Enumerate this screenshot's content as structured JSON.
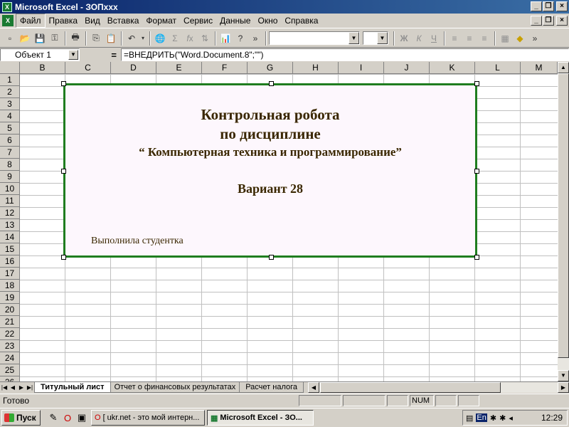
{
  "window": {
    "title": "Microsoft Excel - ЗОПxxx",
    "app_icon": "excel-icon"
  },
  "menu": {
    "items": [
      "Файл",
      "Правка",
      "Вид",
      "Вставка",
      "Формат",
      "Сервис",
      "Данные",
      "Окно",
      "Справка"
    ]
  },
  "toolbar": {
    "bold": "Ж",
    "italic": "К",
    "underline": "Ч",
    "more": "»"
  },
  "formula_bar": {
    "name_box": "Объект 1",
    "equals": "=",
    "formula": "=ВНЕДРИТЬ(\"Word.Document.8\";\"\")"
  },
  "columns": [
    "B",
    "C",
    "D",
    "E",
    "F",
    "G",
    "H",
    "I",
    "J",
    "K",
    "L",
    "M"
  ],
  "rows": [
    "1",
    "2",
    "3",
    "4",
    "5",
    "6",
    "7",
    "8",
    "9",
    "10",
    "11",
    "12",
    "13",
    "14",
    "15",
    "16",
    "17",
    "18",
    "19",
    "20",
    "21",
    "22",
    "23",
    "24",
    "25",
    "26"
  ],
  "embedded": {
    "title_line1": "Контрольная робота",
    "title_line2": "по дисциплине",
    "title_line3": "“ Компьютерная техника и программирование”",
    "variant": "Вариант 28",
    "student": "Выполнила студентка",
    "border_color": "#1f7d1f"
  },
  "sheets": {
    "tabs": [
      "Титульный лист",
      "Отчет о финансовых результатах",
      "Расчет налога"
    ],
    "active": 0
  },
  "status": {
    "text": "Готово",
    "num": "NUM"
  },
  "taskbar": {
    "start": "Пуск",
    "tasks": [
      "[ ukr.net - это мой интерн...",
      "Microsoft Excel - ЗО..."
    ],
    "lang": "En",
    "clock": "12:29"
  }
}
